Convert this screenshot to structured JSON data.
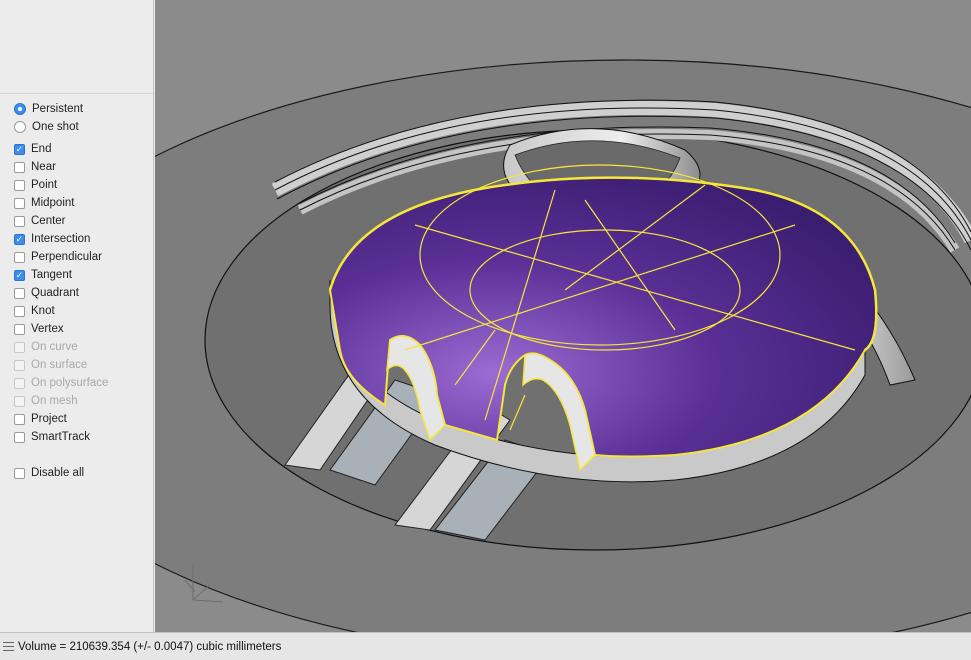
{
  "osnap": {
    "mode": [
      {
        "label": "Persistent",
        "selected": true
      },
      {
        "label": "One shot",
        "selected": false
      }
    ],
    "snaps": [
      {
        "label": "End",
        "checked": true,
        "enabled": true
      },
      {
        "label": "Near",
        "checked": false,
        "enabled": true
      },
      {
        "label": "Point",
        "checked": false,
        "enabled": true
      },
      {
        "label": "Midpoint",
        "checked": false,
        "enabled": true
      },
      {
        "label": "Center",
        "checked": false,
        "enabled": true
      },
      {
        "label": "Intersection",
        "checked": true,
        "enabled": true
      },
      {
        "label": "Perpendicular",
        "checked": false,
        "enabled": true
      },
      {
        "label": "Tangent",
        "checked": true,
        "enabled": true
      },
      {
        "label": "Quadrant",
        "checked": false,
        "enabled": true
      },
      {
        "label": "Knot",
        "checked": false,
        "enabled": true
      },
      {
        "label": "Vertex",
        "checked": false,
        "enabled": true
      },
      {
        "label": "On curve",
        "checked": false,
        "enabled": false
      },
      {
        "label": "On surface",
        "checked": false,
        "enabled": false
      },
      {
        "label": "On polysurface",
        "checked": false,
        "enabled": false
      },
      {
        "label": "On mesh",
        "checked": false,
        "enabled": false
      },
      {
        "label": "Project",
        "checked": false,
        "enabled": true
      },
      {
        "label": "SmartTrack",
        "checked": false,
        "enabled": true
      }
    ],
    "disable_all": {
      "label": "Disable all",
      "checked": false
    }
  },
  "viewport": {
    "colors": {
      "background": "#8a8a8a",
      "model_gray": "#7b7b7b",
      "selected_surface": "#4a2a80",
      "highlight_edges": "#f5e63a"
    }
  },
  "status": {
    "text": "Volume = 210639.354 (+/- 0.0047) cubic millimeters"
  },
  "icons": {
    "status_handle": "list-handle-icon",
    "axis_gizmo": "axis-gizmo-icon"
  }
}
